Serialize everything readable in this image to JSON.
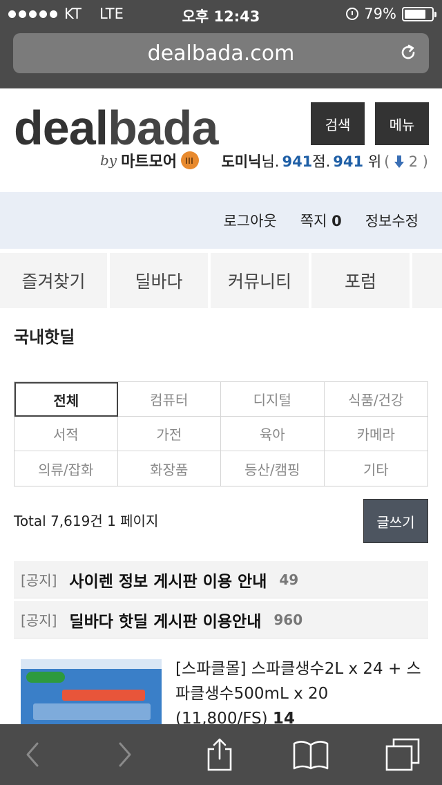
{
  "status_bar": {
    "carrier": "KT",
    "network": "LTE",
    "time": "오후 12:43",
    "battery": "79%",
    "battery_level": 0.79
  },
  "browser": {
    "url": "dealbada.com"
  },
  "header": {
    "logo_deal": "deal",
    "logo_bada": "bada",
    "by": "by",
    "partner": "마트모어",
    "search_button": "검색",
    "menu_button": "메뉴",
    "user": {
      "name": "도미닉",
      "suffix": "님.",
      "points": "941",
      "points_unit": "점.",
      "rank": "941",
      "rank_unit": "위",
      "rank_change_open": "(",
      "rank_change": "2",
      "rank_change_close": ")"
    }
  },
  "account_bar": {
    "logout": "로그아웃",
    "messages_label": "쪽지",
    "messages_count": "0",
    "edit_profile": "정보수정"
  },
  "nav": {
    "tabs": [
      {
        "label": "즐겨찾기"
      },
      {
        "label": "딜바다"
      },
      {
        "label": "커뮤니티"
      },
      {
        "label": "포럼"
      }
    ]
  },
  "board": {
    "title": "국내핫딜",
    "categories": [
      {
        "label": "전체",
        "active": true
      },
      {
        "label": "컴퓨터"
      },
      {
        "label": "디지털"
      },
      {
        "label": "식품/건강"
      },
      {
        "label": "서적"
      },
      {
        "label": "가전"
      },
      {
        "label": "육아"
      },
      {
        "label": "카메라"
      },
      {
        "label": "의류/잡화"
      },
      {
        "label": "화장품"
      },
      {
        "label": "등산/캠핑"
      },
      {
        "label": "기타"
      }
    ],
    "total_text": "Total 7,619건 1 페이지",
    "write_button": "글쓰기",
    "notices": [
      {
        "tag": "[공지]",
        "title": "사이렌 정보 게시판 이용 안내",
        "count": "49"
      },
      {
        "tag": "[공지]",
        "title": "딜바다 핫딜 게시판 이용안내",
        "count": "960"
      }
    ],
    "posts": [
      {
        "title": "[스파클몰] 스파클생수2L x 24 + 스파클생수500mL x 20 (11,800/FS)",
        "comments": "14"
      }
    ]
  },
  "colors": {
    "dark_button": "#333333",
    "link_blue": "#1f5fa6",
    "account_bar_bg": "#e9eef6",
    "browser_chrome": "#4b4b4b"
  }
}
